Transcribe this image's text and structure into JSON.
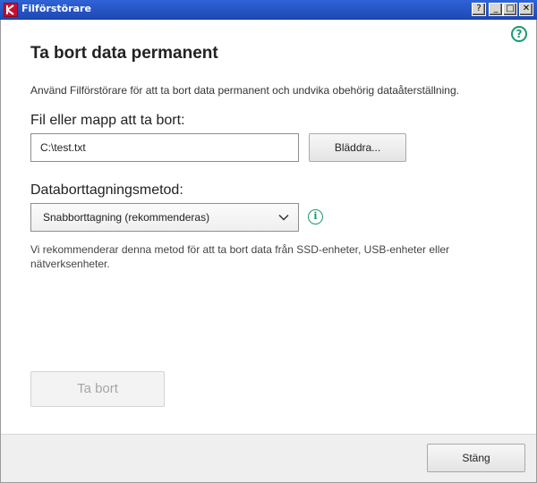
{
  "window": {
    "title": "Filförstörare",
    "controls": {
      "help": "?",
      "minimize": "_",
      "maximize": "□",
      "close": "✕"
    }
  },
  "help_icon_glyph": "?",
  "page": {
    "title": "Ta bort data permanent",
    "description": "Använd Filförstörare för att ta bort data permanent och undvika obehörig dataåterställning."
  },
  "file_section": {
    "label": "Fil eller mapp att ta bort:",
    "path_value": "C:\\test.txt",
    "browse_label": "Bläddra..."
  },
  "method_section": {
    "label": "Databorttagningsmetod:",
    "selected": "Snabborttagning (rekommenderas)",
    "info_glyph": "i",
    "note": "Vi rekommenderar denna metod för att ta bort data från SSD-enheter, USB-enheter eller nätverksenheter."
  },
  "actions": {
    "delete_label": "Ta bort",
    "delete_enabled": false,
    "close_label": "Stäng"
  },
  "colors": {
    "accent": "#1a9a6e",
    "titlebar": "#2f63d8",
    "footer": "#efefef",
    "disabled_text": "#a6a6a6"
  }
}
